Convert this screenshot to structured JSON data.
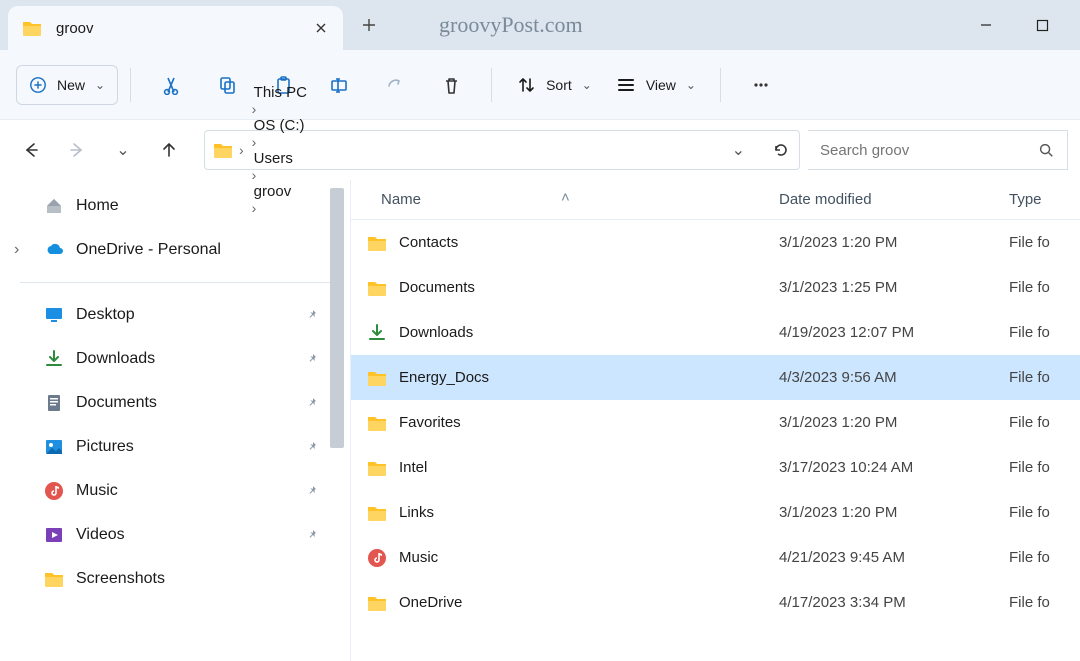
{
  "titlebar": {
    "tab_title": "groov",
    "watermark": "groovyPost.com"
  },
  "toolbar": {
    "new_label": "New",
    "sort_label": "Sort",
    "view_label": "View"
  },
  "breadcrumb": {
    "items": [
      "This PC",
      "OS (C:)",
      "Users",
      "groov"
    ]
  },
  "search": {
    "placeholder": "Search groov"
  },
  "sidebar": {
    "home": "Home",
    "onedrive": "OneDrive - Personal",
    "quick": [
      {
        "label": "Desktop",
        "icon": "desktop",
        "pinned": true
      },
      {
        "label": "Downloads",
        "icon": "downloads",
        "pinned": true
      },
      {
        "label": "Documents",
        "icon": "documents",
        "pinned": true
      },
      {
        "label": "Pictures",
        "icon": "pictures",
        "pinned": true
      },
      {
        "label": "Music",
        "icon": "music",
        "pinned": true
      },
      {
        "label": "Videos",
        "icon": "videos",
        "pinned": true
      },
      {
        "label": "Screenshots",
        "icon": "folder",
        "pinned": false
      }
    ]
  },
  "columns": {
    "name": "Name",
    "date": "Date modified",
    "type": "Type"
  },
  "rows": [
    {
      "name": "Contacts",
      "date": "3/1/2023 1:20 PM",
      "type": "File fo",
      "icon": "folder",
      "selected": false
    },
    {
      "name": "Documents",
      "date": "3/1/2023 1:25 PM",
      "type": "File fo",
      "icon": "folder",
      "selected": false
    },
    {
      "name": "Downloads",
      "date": "4/19/2023 12:07 PM",
      "type": "File fo",
      "icon": "downloads",
      "selected": false
    },
    {
      "name": "Energy_Docs",
      "date": "4/3/2023 9:56 AM",
      "type": "File fo",
      "icon": "folder",
      "selected": true
    },
    {
      "name": "Favorites",
      "date": "3/1/2023 1:20 PM",
      "type": "File fo",
      "icon": "folder",
      "selected": false
    },
    {
      "name": "Intel",
      "date": "3/17/2023 10:24 AM",
      "type": "File fo",
      "icon": "folder",
      "selected": false
    },
    {
      "name": "Links",
      "date": "3/1/2023 1:20 PM",
      "type": "File fo",
      "icon": "folder",
      "selected": false
    },
    {
      "name": "Music",
      "date": "4/21/2023 9:45 AM",
      "type": "File fo",
      "icon": "music",
      "selected": false
    },
    {
      "name": "OneDrive",
      "date": "4/17/2023 3:34 PM",
      "type": "File fo",
      "icon": "folder",
      "selected": false
    }
  ]
}
